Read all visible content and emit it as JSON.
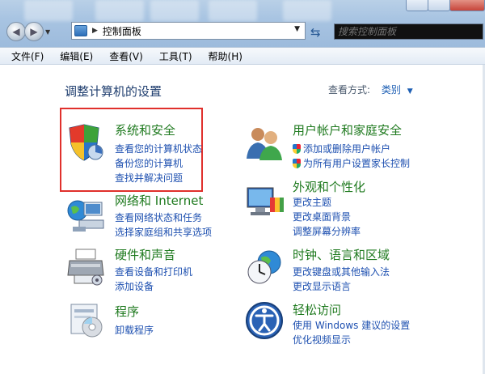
{
  "address": {
    "breadcrumb": "控制面板"
  },
  "search": {
    "placeholder": "搜索控制面板"
  },
  "menu": [
    "文件(F)",
    "编辑(E)",
    "查看(V)",
    "工具(T)",
    "帮助(H)"
  ],
  "page": {
    "heading": "调整计算机的设置",
    "view_by_label": "查看方式:",
    "view_by_value": "类别"
  },
  "categories": [
    {
      "title": "系统和安全",
      "links": [
        "查看您的计算机状态",
        "备份您的计算机",
        "查找并解决问题"
      ],
      "icon": "shield-security-icon"
    },
    {
      "title": "网络和 Internet",
      "links": [
        "查看网络状态和任务",
        "选择家庭组和共享选项"
      ],
      "icon": "network-globe-icon"
    },
    {
      "title": "硬件和声音",
      "links": [
        "查看设备和打印机",
        "添加设备"
      ],
      "icon": "printer-icon"
    },
    {
      "title": "程序",
      "links": [
        "卸载程序"
      ],
      "icon": "programs-icon"
    },
    {
      "title": "用户帐户和家庭安全",
      "links": [
        "添加或删除用户帐户",
        "为所有用户设置家长控制"
      ],
      "icon": "users-icon"
    },
    {
      "title": "外观和个性化",
      "links": [
        "更改主题",
        "更改桌面背景",
        "调整屏幕分辨率"
      ],
      "icon": "monitor-palette-icon"
    },
    {
      "title": "时钟、语言和区域",
      "links": [
        "更改键盘或其他输入法",
        "更改显示语言"
      ],
      "icon": "clock-globe-icon"
    },
    {
      "title": "轻松访问",
      "links": [
        "使用 Windows 建议的设置",
        "优化视频显示"
      ],
      "icon": "ease-of-access-icon"
    }
  ],
  "colors": {
    "category_title": "#1f7a1f",
    "link": "#1e50b0",
    "highlight_box": "#e0302c"
  }
}
